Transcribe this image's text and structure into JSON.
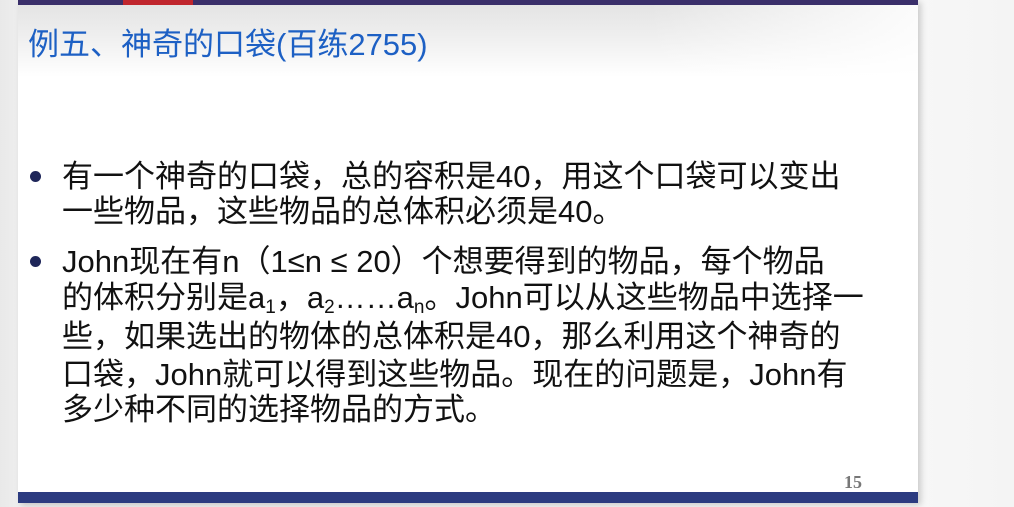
{
  "slide": {
    "title": "例五、神奇的口袋(百练2755)",
    "page_number": "15",
    "colors": {
      "title": "#1d60c4",
      "bullet": "#1e2659",
      "text": "#111111",
      "top_bar": "#3a2f6a",
      "top_bar_accent": "#c0262d",
      "bottom_bar": "#2c3b80"
    }
  },
  "bullet_1": {
    "line_1": "有一个神奇的口袋，总的容积是40，用这个口袋可以变出",
    "line_2": "一些物品，这些物品的总体积必须是40。"
  },
  "bullet_2": {
    "line_1": "John现在有n（1≤n ≤ 20）个想要得到的物品，每个物品",
    "line_2": {
      "a": "的体积分别是a",
      "sub_1": "1",
      "b": "，a",
      "sub_2": "2",
      "c": "……a",
      "sub_3": "n",
      "d": "。John可以从这些物品中选择一"
    },
    "line_3": "些，如果选出的物体的总体积是40，那么利用这个神奇的",
    "line_4": "口袋，John就可以得到这些物品。现在的问题是，John有",
    "line_5": "多少种不同的选择物品的方式。"
  }
}
